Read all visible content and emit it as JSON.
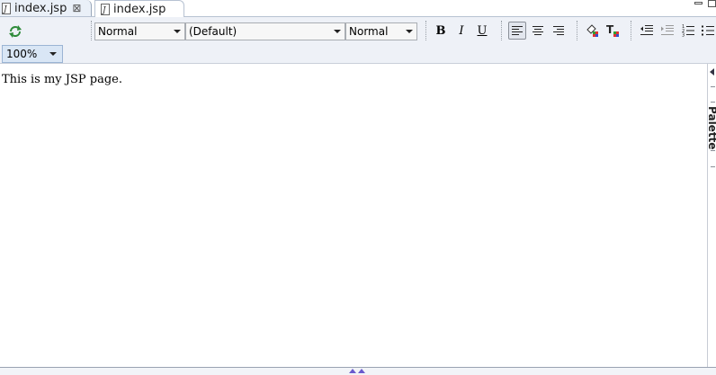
{
  "tabs": [
    {
      "label": "index.jsp",
      "close": "⊠"
    },
    {
      "label": "index.jsp"
    }
  ],
  "toolbar": {
    "paragraph_format": "Normal",
    "font_family": "(Default)",
    "font_size": "Normal",
    "bold": "B",
    "italic": "I",
    "underline": "U",
    "zoom": "100%"
  },
  "editor": {
    "text": "This is my JSP page."
  },
  "palette": {
    "label": "Palette"
  },
  "colors": {
    "tab_active_bg": "#eaf0f8",
    "toolbar_bg": "#eef1f7",
    "zoom_bg": "#d9e6f5"
  }
}
